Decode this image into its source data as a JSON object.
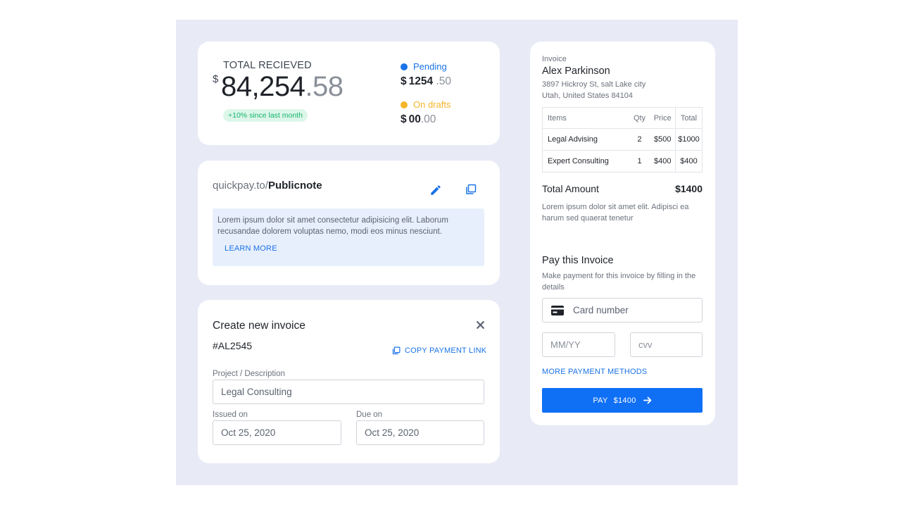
{
  "total_received": {
    "label": "TOTAL RECIEVED",
    "currency": "$",
    "amount_int": "84,254",
    "amount_dec": ".58",
    "badge": "+10% since last month"
  },
  "stats": {
    "pending": {
      "label": "Pending",
      "currency": "$",
      "int": "1254",
      "dec": " .50",
      "color": "#1a73e8"
    },
    "drafts": {
      "label": "On drafts",
      "currency": "$",
      "int": "00",
      "dec": ".00",
      "color": "#f4b52a"
    }
  },
  "public_link": {
    "prefix": "quickpay.to/",
    "name": "Publicnote",
    "edit_icon": "pencil-icon",
    "copy_icon": "copy-icon",
    "note": "Lorem ipsum dolor sit amet consectetur adipisicing elit. Laborum recusandae dolorem voluptas nemo, modi eos minus nesciunt.",
    "learn_more": "LEARN MORE"
  },
  "create_invoice": {
    "title": "Create new invoice",
    "number": "#AL2545",
    "copy_link": "COPY PAYMENT LINK",
    "project_label": "Project / Description",
    "project_value": "Legal Consulting",
    "issued_label": "Issued on",
    "issued_value": "Oct 25, 2020",
    "due_label": "Due on",
    "due_value": "Oct 25, 2020"
  },
  "invoice": {
    "label": "Invoice",
    "name": "Alex Parkinson",
    "address_line1": "3897 Hickroy St, salt Lake city",
    "address_line2": "Utah, United States 84104",
    "columns": [
      "Items",
      "Qty",
      "Price",
      "Total"
    ],
    "rows": [
      {
        "item": "Legal Advising",
        "qty": "2",
        "price": "$500",
        "total": "$1000"
      },
      {
        "item": "Expert Consulting",
        "qty": "1",
        "price": "$400",
        "total": "$400"
      }
    ],
    "total_label": "Total Amount",
    "total_value": "$1400",
    "description": "Lorem ipsum dolor sit amet elit. Adipisci ea harum sed quaerat tenetur"
  },
  "payment": {
    "title": "Pay this Invoice",
    "description": "Make payment for this invoice by filling in the details",
    "card_placeholder": "Card number",
    "expiry_placeholder": "MM/YY",
    "cvv_placeholder": "cvv",
    "more_methods": "MORE PAYMENT METHODS",
    "pay_label": "PAY",
    "pay_amount": "$1400"
  }
}
